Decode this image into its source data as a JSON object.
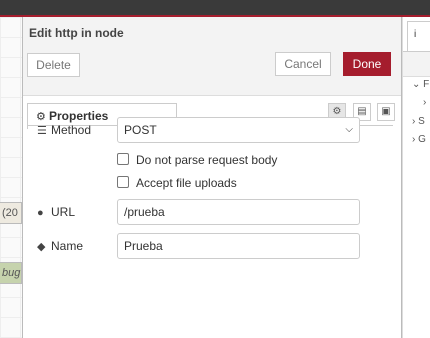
{
  "tray": {
    "title": "Edit http in node",
    "delete_label": "Delete",
    "cancel_label": "Cancel",
    "done_label": "Done",
    "tab_properties": "Properties"
  },
  "form": {
    "method_label": "Method",
    "method_value": "POST",
    "no_parse_label": "Do not parse request body",
    "no_parse_checked": false,
    "accept_uploads_label": "Accept file uploads",
    "accept_uploads_checked": false,
    "url_label": "URL",
    "url_value": "/prueba",
    "name_label": "Name",
    "name_value": "Prueba"
  },
  "canvas": {
    "frag1": "(20",
    "frag2": "bug"
  },
  "sidebar": {
    "tab_icon": "i",
    "rows": [
      {
        "chev": "⌄",
        "text": "F"
      },
      {
        "chev": "",
        "text": "›"
      },
      {
        "chev": "›",
        "text": "S"
      },
      {
        "chev": "›",
        "text": "G"
      }
    ]
  },
  "colors": {
    "accent": "#a51d2d",
    "topbar": "#3a3a3a"
  },
  "icons": {
    "properties_tab": "gear-icon",
    "method": "list-icon",
    "url": "globe-icon",
    "name": "tag-icon"
  }
}
